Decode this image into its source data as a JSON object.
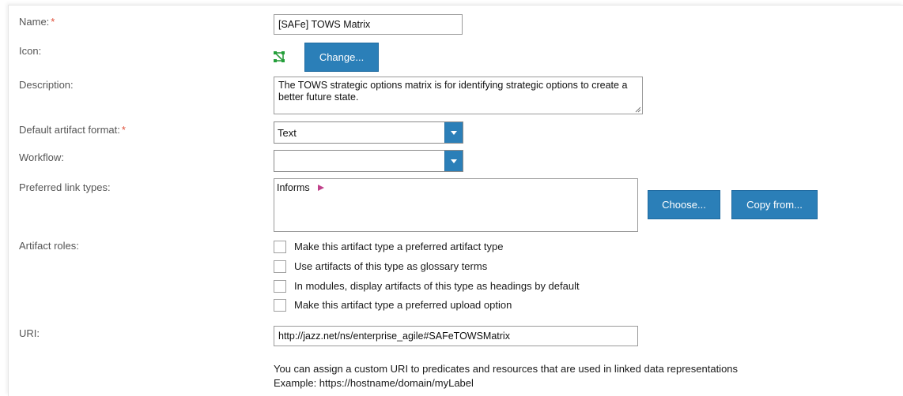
{
  "form": {
    "name": {
      "label": "Name:",
      "required_mark": "*",
      "value": "[SAFe] TOWS Matrix"
    },
    "icon": {
      "label": "Icon:",
      "icon_name": "network-diagram-icon",
      "change_button": "Change..."
    },
    "description": {
      "label": "Description:",
      "value": "The TOWS strategic options matrix is for identifying strategic options to create a better future state."
    },
    "default_format": {
      "label": "Default artifact format:",
      "required_mark": "*",
      "value": "Text"
    },
    "workflow": {
      "label": "Workflow:",
      "value": ""
    },
    "link_types": {
      "label": "Preferred link types:",
      "items": [
        "Informs"
      ],
      "choose_button": "Choose...",
      "copy_button": "Copy from..."
    },
    "artifact_roles": {
      "label": "Artifact roles:",
      "options": [
        {
          "label": "Make this artifact type a preferred artifact type",
          "checked": false
        },
        {
          "label": "Use artifacts of this type as glossary terms",
          "checked": false
        },
        {
          "label": "In modules, display artifacts of this type as headings by default",
          "checked": false
        },
        {
          "label": "Make this artifact type a preferred upload option",
          "checked": false
        }
      ]
    },
    "uri": {
      "label": "URI:",
      "value": "http://jazz.net/ns/enterprise_agile#SAFeTOWSMatrix",
      "hint_line1": "You can assign a custom URI to predicates and resources that are used in linked data representations",
      "hint_line2": "Example: https://hostname/domain/myLabel"
    }
  },
  "colors": {
    "accent": "#2b7fb8",
    "required": "#e0503a",
    "link_arrow": "#c0408a"
  }
}
